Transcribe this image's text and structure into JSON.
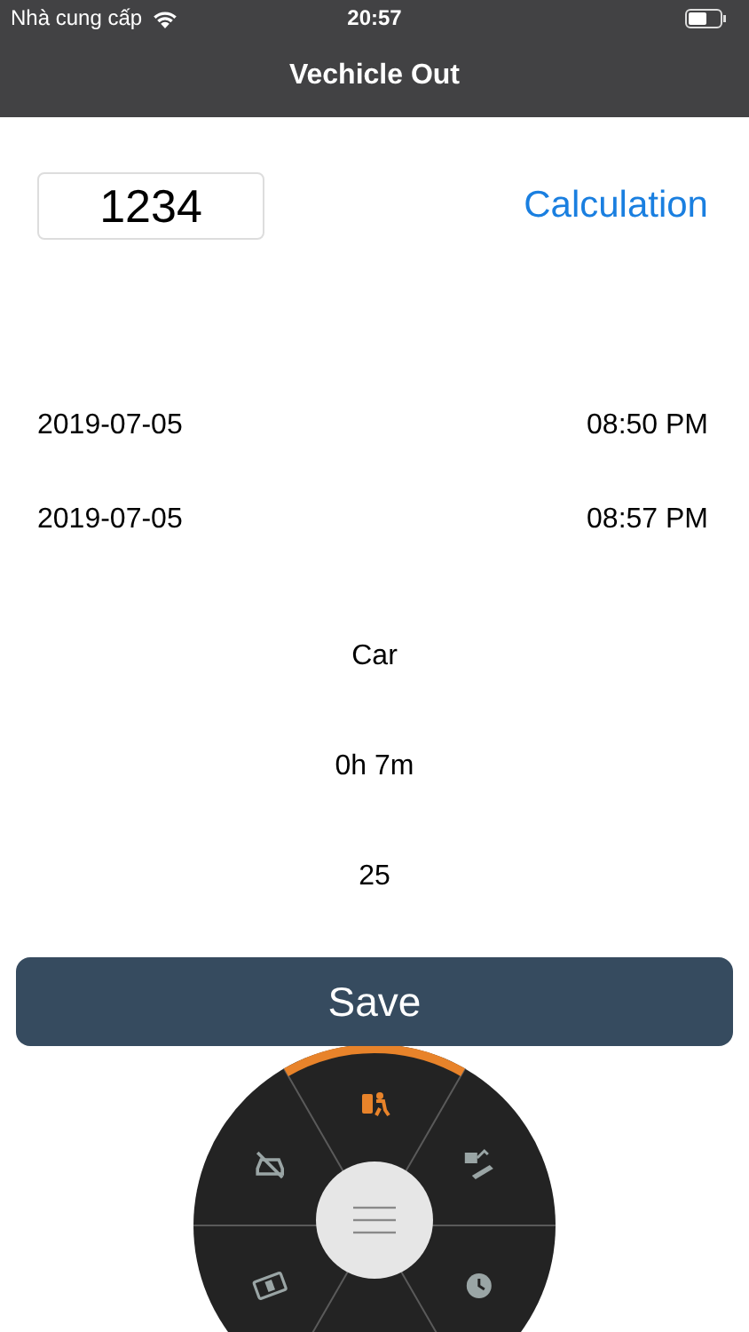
{
  "status_bar": {
    "carrier": "Nhà cung cấp",
    "time": "20:57"
  },
  "window": {
    "title": "Vechicle Out"
  },
  "plate_field": {
    "value": "1234"
  },
  "calculation_button": "Calculation",
  "times": [
    {
      "date": "2019-07-05",
      "time": "08:50 PM"
    },
    {
      "date": "2019-07-05",
      "time": "08:57 PM"
    }
  ],
  "results": [
    "Car",
    "0h 7m",
    "25"
  ],
  "save_button": "Save",
  "radial_menu": {
    "items": [
      {
        "selected": true
      },
      {
        "selected": false
      },
      {
        "selected": false
      },
      {
        "selected": false
      },
      {
        "selected": false
      }
    ]
  }
}
